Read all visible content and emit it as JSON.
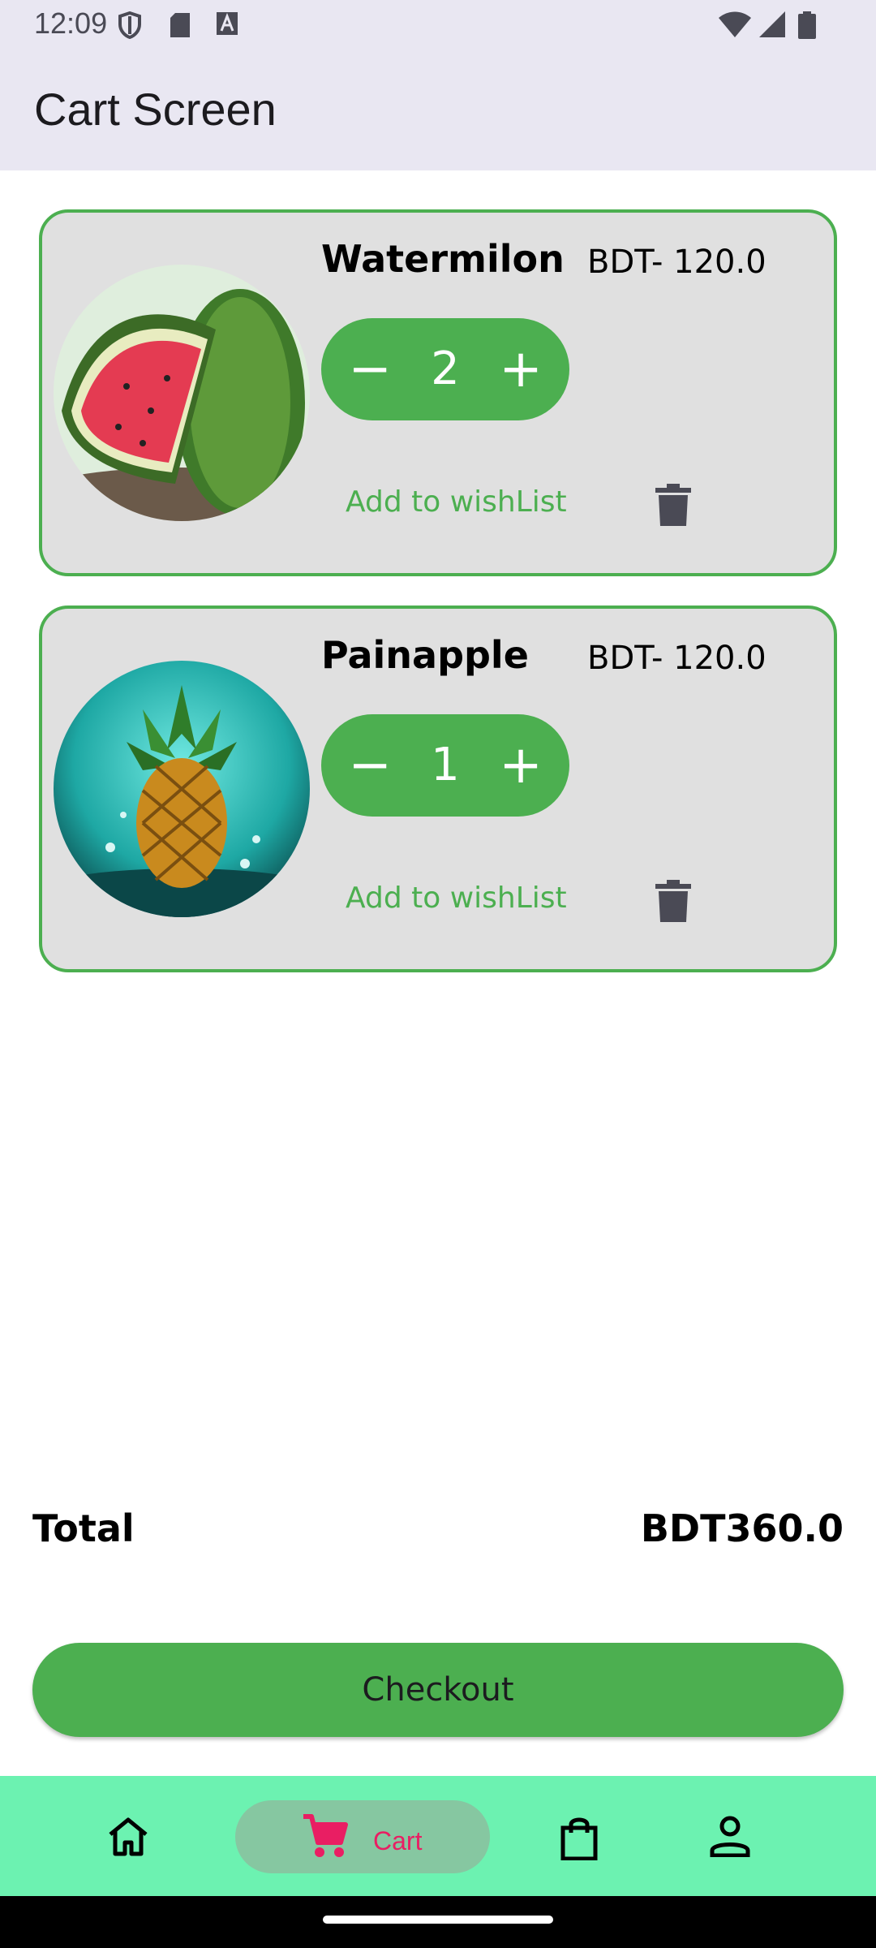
{
  "status_bar": {
    "time": "12:09",
    "icons": [
      "shield-icon",
      "sd-card-icon",
      "font-a-icon",
      "wifi-icon",
      "signal-icon",
      "battery-icon"
    ]
  },
  "app_bar": {
    "title": "Cart Screen"
  },
  "cart": {
    "items": [
      {
        "name": "Watermilon",
        "price": "BDT- 120.0",
        "quantity": "2",
        "minus_label": "−",
        "plus_label": "+",
        "wishlist_label": "Add to wishList",
        "image": "watermelon-image"
      },
      {
        "name": "Painapple",
        "price": "BDT- 120.0",
        "quantity": "1",
        "minus_label": "−",
        "plus_label": "+",
        "wishlist_label": "Add to wishList",
        "image": "pineapple-image"
      }
    ]
  },
  "summary": {
    "total_label": "Total",
    "total_value": "BDT360.0"
  },
  "checkout": {
    "label": "Checkout"
  },
  "bottom_nav": {
    "items": [
      {
        "icon": "home-icon",
        "selected": false
      },
      {
        "icon": "cart-icon",
        "label": "Cart",
        "selected": true
      },
      {
        "icon": "shopping-bag-icon",
        "selected": false
      },
      {
        "icon": "person-icon",
        "selected": false
      }
    ]
  },
  "colors": {
    "accent": "#4caf50",
    "nav_background": "#6cf2b1",
    "nav_selected": "#e91e63",
    "card_background": "#e0e0e0",
    "app_bar": "#e9e7f2"
  }
}
